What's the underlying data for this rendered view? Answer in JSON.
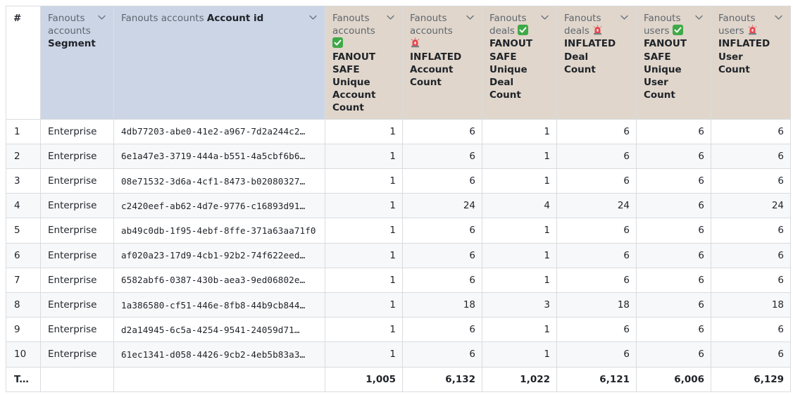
{
  "table": {
    "index_header": "#",
    "columns": [
      {
        "id": "segment",
        "kind": "dim",
        "prefix": "Fanouts accounts",
        "label": "Segment",
        "emoji": ""
      },
      {
        "id": "account_id",
        "kind": "dim",
        "prefix": "Fanouts accounts",
        "label": "Account id",
        "emoji": ""
      },
      {
        "id": "safe_account_count",
        "kind": "met",
        "prefix": "Fanouts accounts",
        "label": "FANOUT SAFE Unique Account Count",
        "emoji": "check-emoji-icon"
      },
      {
        "id": "inflated_account_count",
        "kind": "met",
        "prefix": "Fanouts accounts",
        "label": "INFLATED Account Count",
        "emoji": "siren-emoji-icon"
      },
      {
        "id": "safe_deal_count",
        "kind": "met",
        "prefix": "Fanouts deals",
        "label": "FANOUT SAFE Unique Deal Count",
        "emoji": "check-emoji-icon"
      },
      {
        "id": "inflated_deal_count",
        "kind": "met",
        "prefix": "Fanouts deals",
        "label": "INFLATED Deal Count",
        "emoji": "siren-emoji-icon"
      },
      {
        "id": "safe_user_count",
        "kind": "met",
        "prefix": "Fanouts users",
        "label": "FANOUT SAFE Unique User Count",
        "emoji": "check-emoji-icon"
      },
      {
        "id": "inflated_user_count",
        "kind": "met",
        "prefix": "Fanouts users",
        "label": "INFLATED User Count",
        "emoji": "siren-emoji-icon"
      }
    ],
    "rows": [
      {
        "index": "1",
        "cells": [
          "Enterprise",
          "4db77203-abe0-41e2-a967-7d2a244c2…",
          "1",
          "6",
          "1",
          "6",
          "6",
          "6"
        ]
      },
      {
        "index": "2",
        "cells": [
          "Enterprise",
          "6e1a47e3-3719-444a-b551-4a5cbf6b6…",
          "1",
          "6",
          "1",
          "6",
          "6",
          "6"
        ]
      },
      {
        "index": "3",
        "cells": [
          "Enterprise",
          "08e71532-3d6a-4cf1-8473-b02080327…",
          "1",
          "6",
          "1",
          "6",
          "6",
          "6"
        ]
      },
      {
        "index": "4",
        "cells": [
          "Enterprise",
          "c2420eef-ab62-4d7e-9776-c16893d91…",
          "1",
          "24",
          "4",
          "24",
          "6",
          "24"
        ]
      },
      {
        "index": "5",
        "cells": [
          "Enterprise",
          "ab49c0db-1f95-4ebf-8ffe-371a63aa71f0",
          "1",
          "6",
          "1",
          "6",
          "6",
          "6"
        ]
      },
      {
        "index": "6",
        "cells": [
          "Enterprise",
          "af020a23-17d9-4cb1-92b2-74f622eed…",
          "1",
          "6",
          "1",
          "6",
          "6",
          "6"
        ]
      },
      {
        "index": "7",
        "cells": [
          "Enterprise",
          "6582abf6-0387-430b-aea3-9ed06802e…",
          "1",
          "6",
          "1",
          "6",
          "6",
          "6"
        ]
      },
      {
        "index": "8",
        "cells": [
          "Enterprise",
          "1a386580-cf51-446e-8fb8-44b9cb844…",
          "1",
          "18",
          "3",
          "18",
          "6",
          "18"
        ]
      },
      {
        "index": "9",
        "cells": [
          "Enterprise",
          "d2a14945-6c5a-4254-9541-24059d71…",
          "1",
          "6",
          "1",
          "6",
          "6",
          "6"
        ]
      },
      {
        "index": "10",
        "cells": [
          "Enterprise",
          "61ec1341-d058-4426-9cb2-4eb5b83a3…",
          "1",
          "6",
          "1",
          "6",
          "6",
          "6"
        ]
      }
    ],
    "total": {
      "label": "Total",
      "cells": [
        "",
        "",
        "1,005",
        "6,132",
        "1,022",
        "6,121",
        "6,006",
        "6,129"
      ]
    }
  },
  "colors": {
    "dimension_header_bg": "#ccd5e6",
    "metric_header_bg": "#e0d6cb",
    "alt_row_bg": "#f6f8f9",
    "border": "#d9dcdf",
    "check_emoji": "#3fa948",
    "siren_emoji": "#e5484d"
  }
}
